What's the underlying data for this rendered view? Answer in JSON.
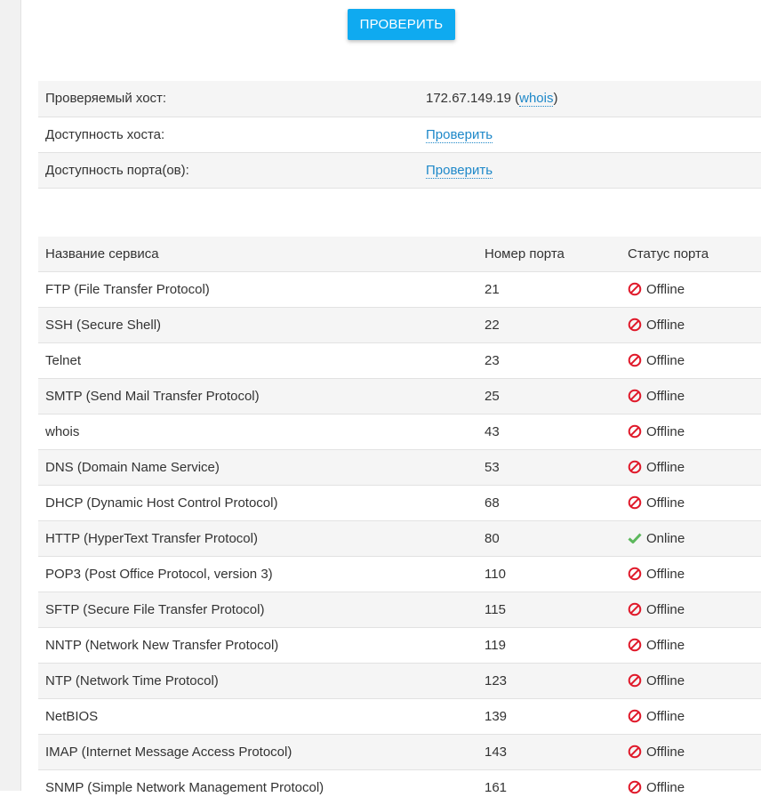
{
  "check_button": {
    "label": "ПРОВЕРИТЬ"
  },
  "host_info": {
    "host_label": "Проверяемый хост:",
    "host_ip": "172.67.149.19",
    "whois_link": "whois",
    "availability_label": "Доступность хоста:",
    "availability_link": "Проверить",
    "ports_label": "Доступность порта(ов):",
    "ports_link": "Проверить"
  },
  "port_table": {
    "headers": {
      "service": "Название сервиса",
      "port": "Номер порта",
      "status": "Статус порта"
    },
    "rows": [
      {
        "service": "FTP (File Transfer Protocol)",
        "port": "21",
        "status": "Offline",
        "online": false
      },
      {
        "service": "SSH (Secure Shell)",
        "port": "22",
        "status": "Offline",
        "online": false
      },
      {
        "service": "Telnet",
        "port": "23",
        "status": "Offline",
        "online": false
      },
      {
        "service": "SMTP (Send Mail Transfer Protocol)",
        "port": "25",
        "status": "Offline",
        "online": false
      },
      {
        "service": "whois",
        "port": "43",
        "status": "Offline",
        "online": false
      },
      {
        "service": "DNS (Domain Name Service)",
        "port": "53",
        "status": "Offline",
        "online": false
      },
      {
        "service": "DHCP (Dynamic Host Control Protocol)",
        "port": "68",
        "status": "Offline",
        "online": false
      },
      {
        "service": "HTTP (HyperText Transfer Protocol)",
        "port": "80",
        "status": "Online",
        "online": true
      },
      {
        "service": "POP3 (Post Office Protocol, version 3)",
        "port": "110",
        "status": "Offline",
        "online": false
      },
      {
        "service": "SFTP (Secure File Transfer Protocol)",
        "port": "115",
        "status": "Offline",
        "online": false
      },
      {
        "service": "NNTP (Network New Transfer Protocol)",
        "port": "119",
        "status": "Offline",
        "online": false
      },
      {
        "service": "NTP (Network Time Protocol)",
        "port": "123",
        "status": "Offline",
        "online": false
      },
      {
        "service": "NetBIOS",
        "port": "139",
        "status": "Offline",
        "online": false
      },
      {
        "service": "IMAP (Internet Message Access Protocol)",
        "port": "143",
        "status": "Offline",
        "online": false
      },
      {
        "service": "SNMP (Simple Network Management Protocol)",
        "port": "161",
        "status": "Offline",
        "online": false
      }
    ]
  },
  "colors": {
    "accent": "#0faaf0",
    "link": "#1e88c9",
    "offline": "#e0192a",
    "online": "#5cb85c"
  },
  "icons": {
    "offline": "no-entry-icon",
    "online": "checkmark-icon"
  }
}
